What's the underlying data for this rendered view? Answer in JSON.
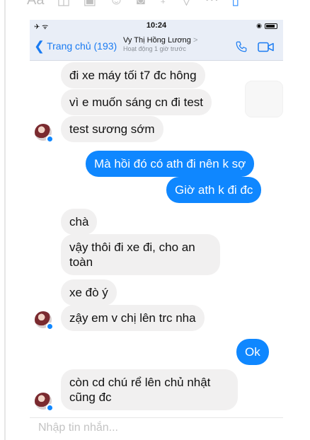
{
  "status_bar": {
    "signal": "✈ ᯤ",
    "time": "10:24"
  },
  "header": {
    "back_label": "Trang chủ (193)",
    "contact_name": "Vy Thị Hồng Lương",
    "contact_chevron": ">",
    "active_status": "Hoạt động 1 giờ trước"
  },
  "messages": [
    {
      "side": "in",
      "text": "đi xe máy tối t7 đc hông"
    },
    {
      "side": "in",
      "text": "vì e muốn sáng cn đi test"
    },
    {
      "side": "in",
      "text": "test sương sớm"
    },
    {
      "side": "out",
      "text": "Mà hồi đó có ath đi nên k sợ"
    },
    {
      "side": "out",
      "text": "Giờ ath k đi đc"
    },
    {
      "side": "in",
      "text": "chà"
    },
    {
      "side": "in",
      "text": "vậy thôi đi xe đi, cho an toàn"
    },
    {
      "side": "in",
      "text": "xe đò ý"
    },
    {
      "side": "in",
      "text": "zậy em v chị lên trc nha"
    },
    {
      "side": "out",
      "text": "Ok"
    },
    {
      "side": "in",
      "text": "còn cd chú rể lên chủ nhật cũng đc"
    }
  ],
  "composer": {
    "placeholder": "Nhập tin nhắn..."
  },
  "colors": {
    "accent": "#0f87ff",
    "incoming_bubble": "#f1f0f0",
    "header_bg": "#e9eef7"
  },
  "icons": [
    "text-format-icon",
    "camera-icon",
    "gallery-icon",
    "emoji-icon",
    "gif-icon",
    "microphone-icon",
    "location-icon",
    "more-icon",
    "like-icon",
    "back-chevron-icon",
    "phone-call-icon",
    "video-call-icon",
    "messenger-badge-icon"
  ]
}
